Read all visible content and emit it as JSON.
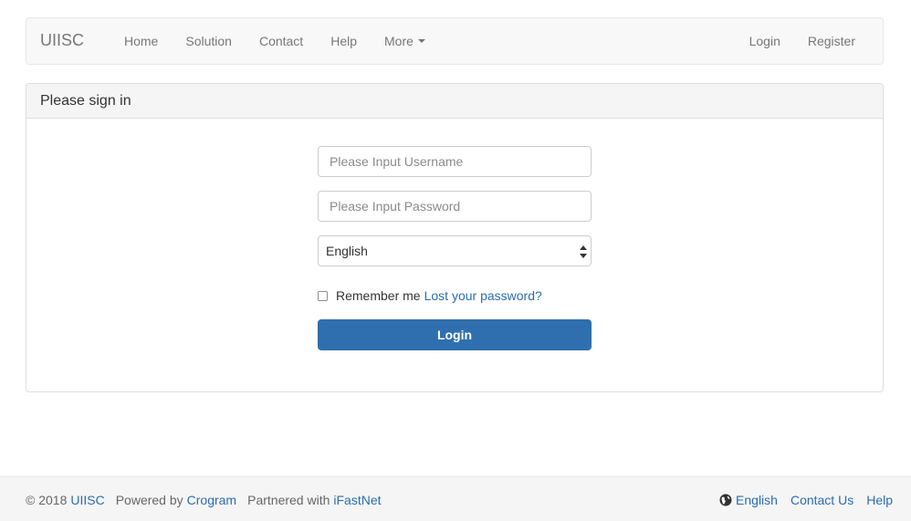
{
  "navbar": {
    "brand": "UIISC",
    "left_items": [
      "Home",
      "Solution",
      "Contact",
      "Help"
    ],
    "more_label": "More",
    "right_items": [
      "Login",
      "Register"
    ]
  },
  "panel": {
    "title": "Please sign in"
  },
  "form": {
    "username_placeholder": "Please Input Username",
    "password_placeholder": "Please Input Password",
    "language_selected": "English",
    "remember_label": "Remember me",
    "lost_password_link": "Lost your password?",
    "login_button": "Login"
  },
  "footer": {
    "copyright": "© 2018",
    "site_link": "UIISC",
    "powered_by": "Powered by",
    "powered_link": "Crogram",
    "partnered_with": "Partnered with",
    "partner_link": "iFastNet",
    "language_link": "English",
    "contact_link": "Contact Us",
    "help_link": "Help"
  },
  "colors": {
    "link": "#2a6cb0",
    "primary_button": "#2f6fb0",
    "navbar_bg": "#f8f8f8",
    "footer_bg": "#f5f5f5"
  },
  "icons": {
    "language": "globe-icon",
    "more": "caret-down-icon",
    "select": "select-arrows-icon"
  }
}
